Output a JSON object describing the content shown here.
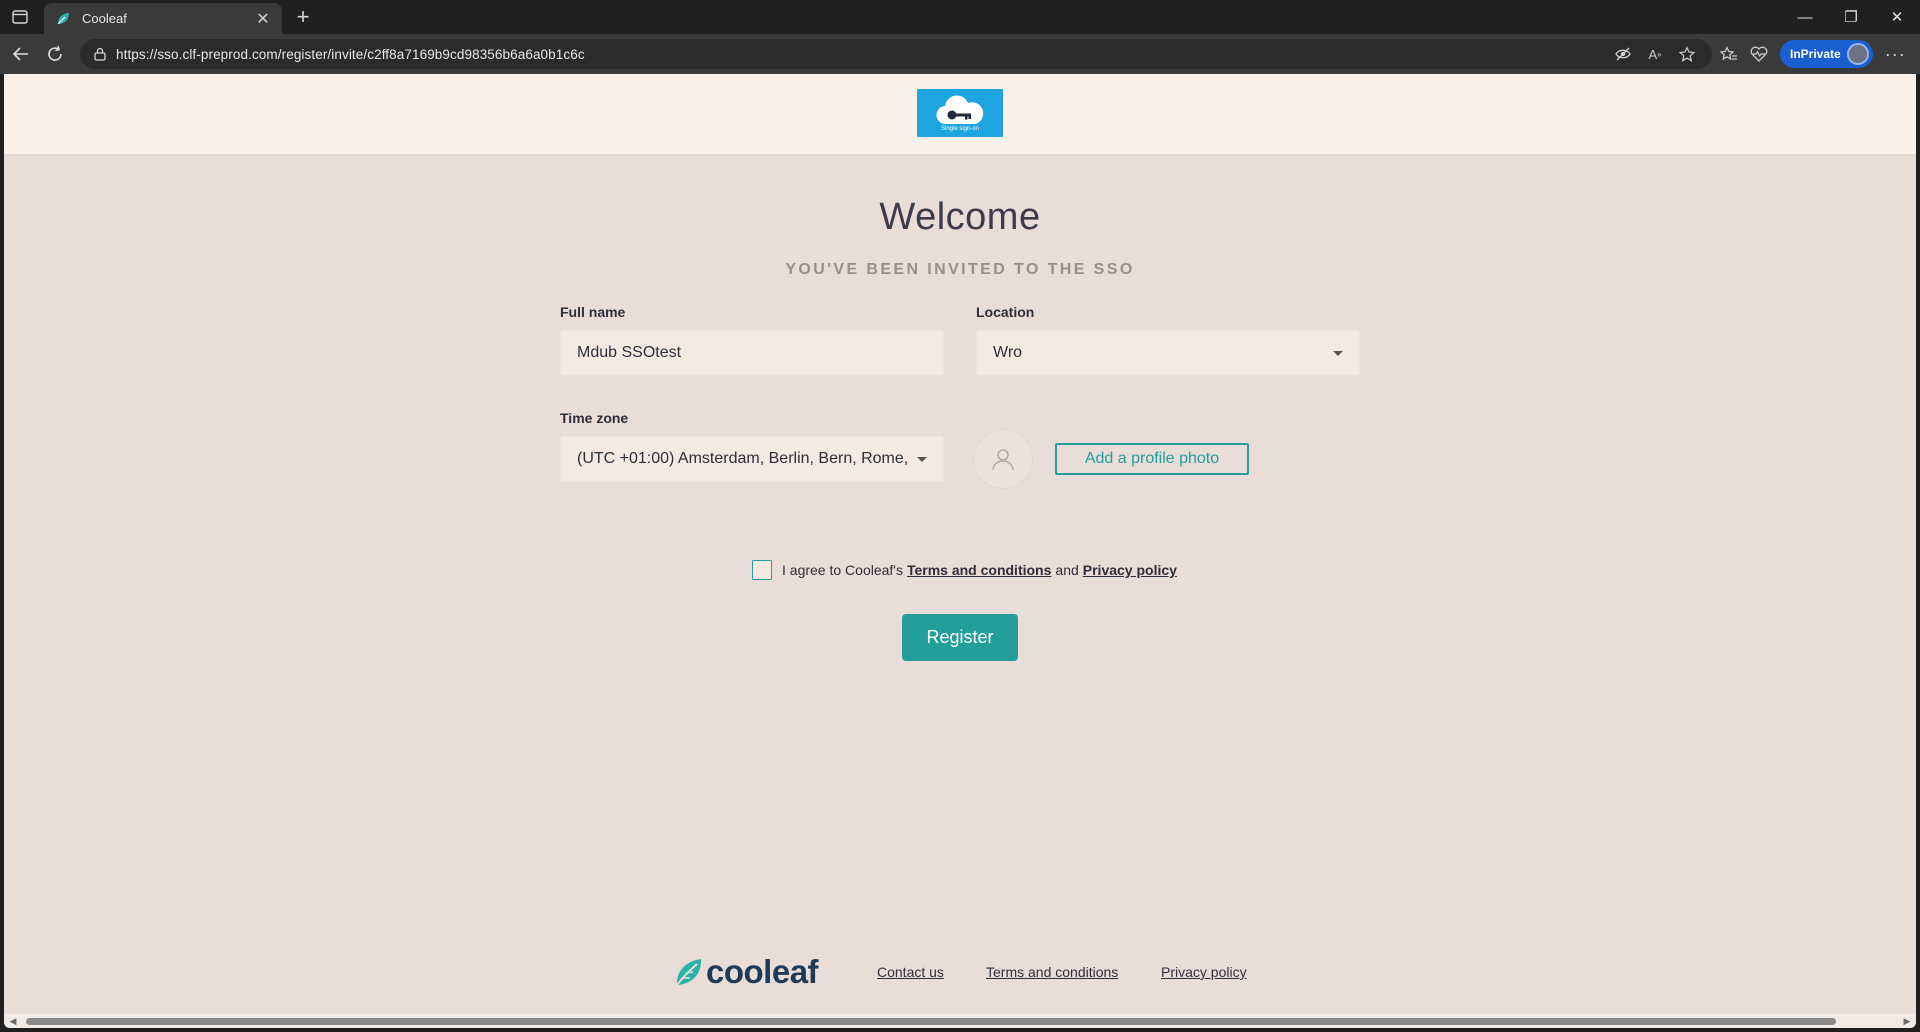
{
  "browser": {
    "tab_title": "Cooleaf",
    "tab_close": "✕",
    "new_tab": "+",
    "url": "https://sso.clf-preprod.com/register/invite/c2ff8a7169b9cd98356b6a6a0b1c6c",
    "inprivate_label": "InPrivate",
    "more": "···",
    "win_minimize": "—",
    "win_restore": "❐",
    "win_close": "✕"
  },
  "header": {
    "logo_text": "Single sign-on"
  },
  "form": {
    "title": "Welcome",
    "subtitle": "YOU'VE BEEN INVITED TO THE SSO",
    "full_name_label": "Full name",
    "full_name_value": "Mdub SSOtest",
    "location_label": "Location",
    "location_value": "Wro",
    "timezone_label": "Time zone",
    "timezone_value": "(UTC +01:00)  Amsterdam, Berlin, Bern, Rome,",
    "add_photo_label": "Add a profile photo",
    "agree_prefix": "I agree to Cooleaf's",
    "terms_link": "Terms and conditions",
    "agree_and": "and",
    "privacy_link": "Privacy policy",
    "register_label": "Register"
  },
  "footer": {
    "brand": "cooleaf",
    "contact": "Contact us",
    "terms": "Terms and conditions",
    "privacy": "Privacy policy"
  },
  "colors": {
    "accent": "#249e9a",
    "page_bg": "#e8ddd8",
    "header_bg": "#fcf1ea",
    "sso_blue": "#1ea4df",
    "brand_navy": "#1f3a56"
  }
}
